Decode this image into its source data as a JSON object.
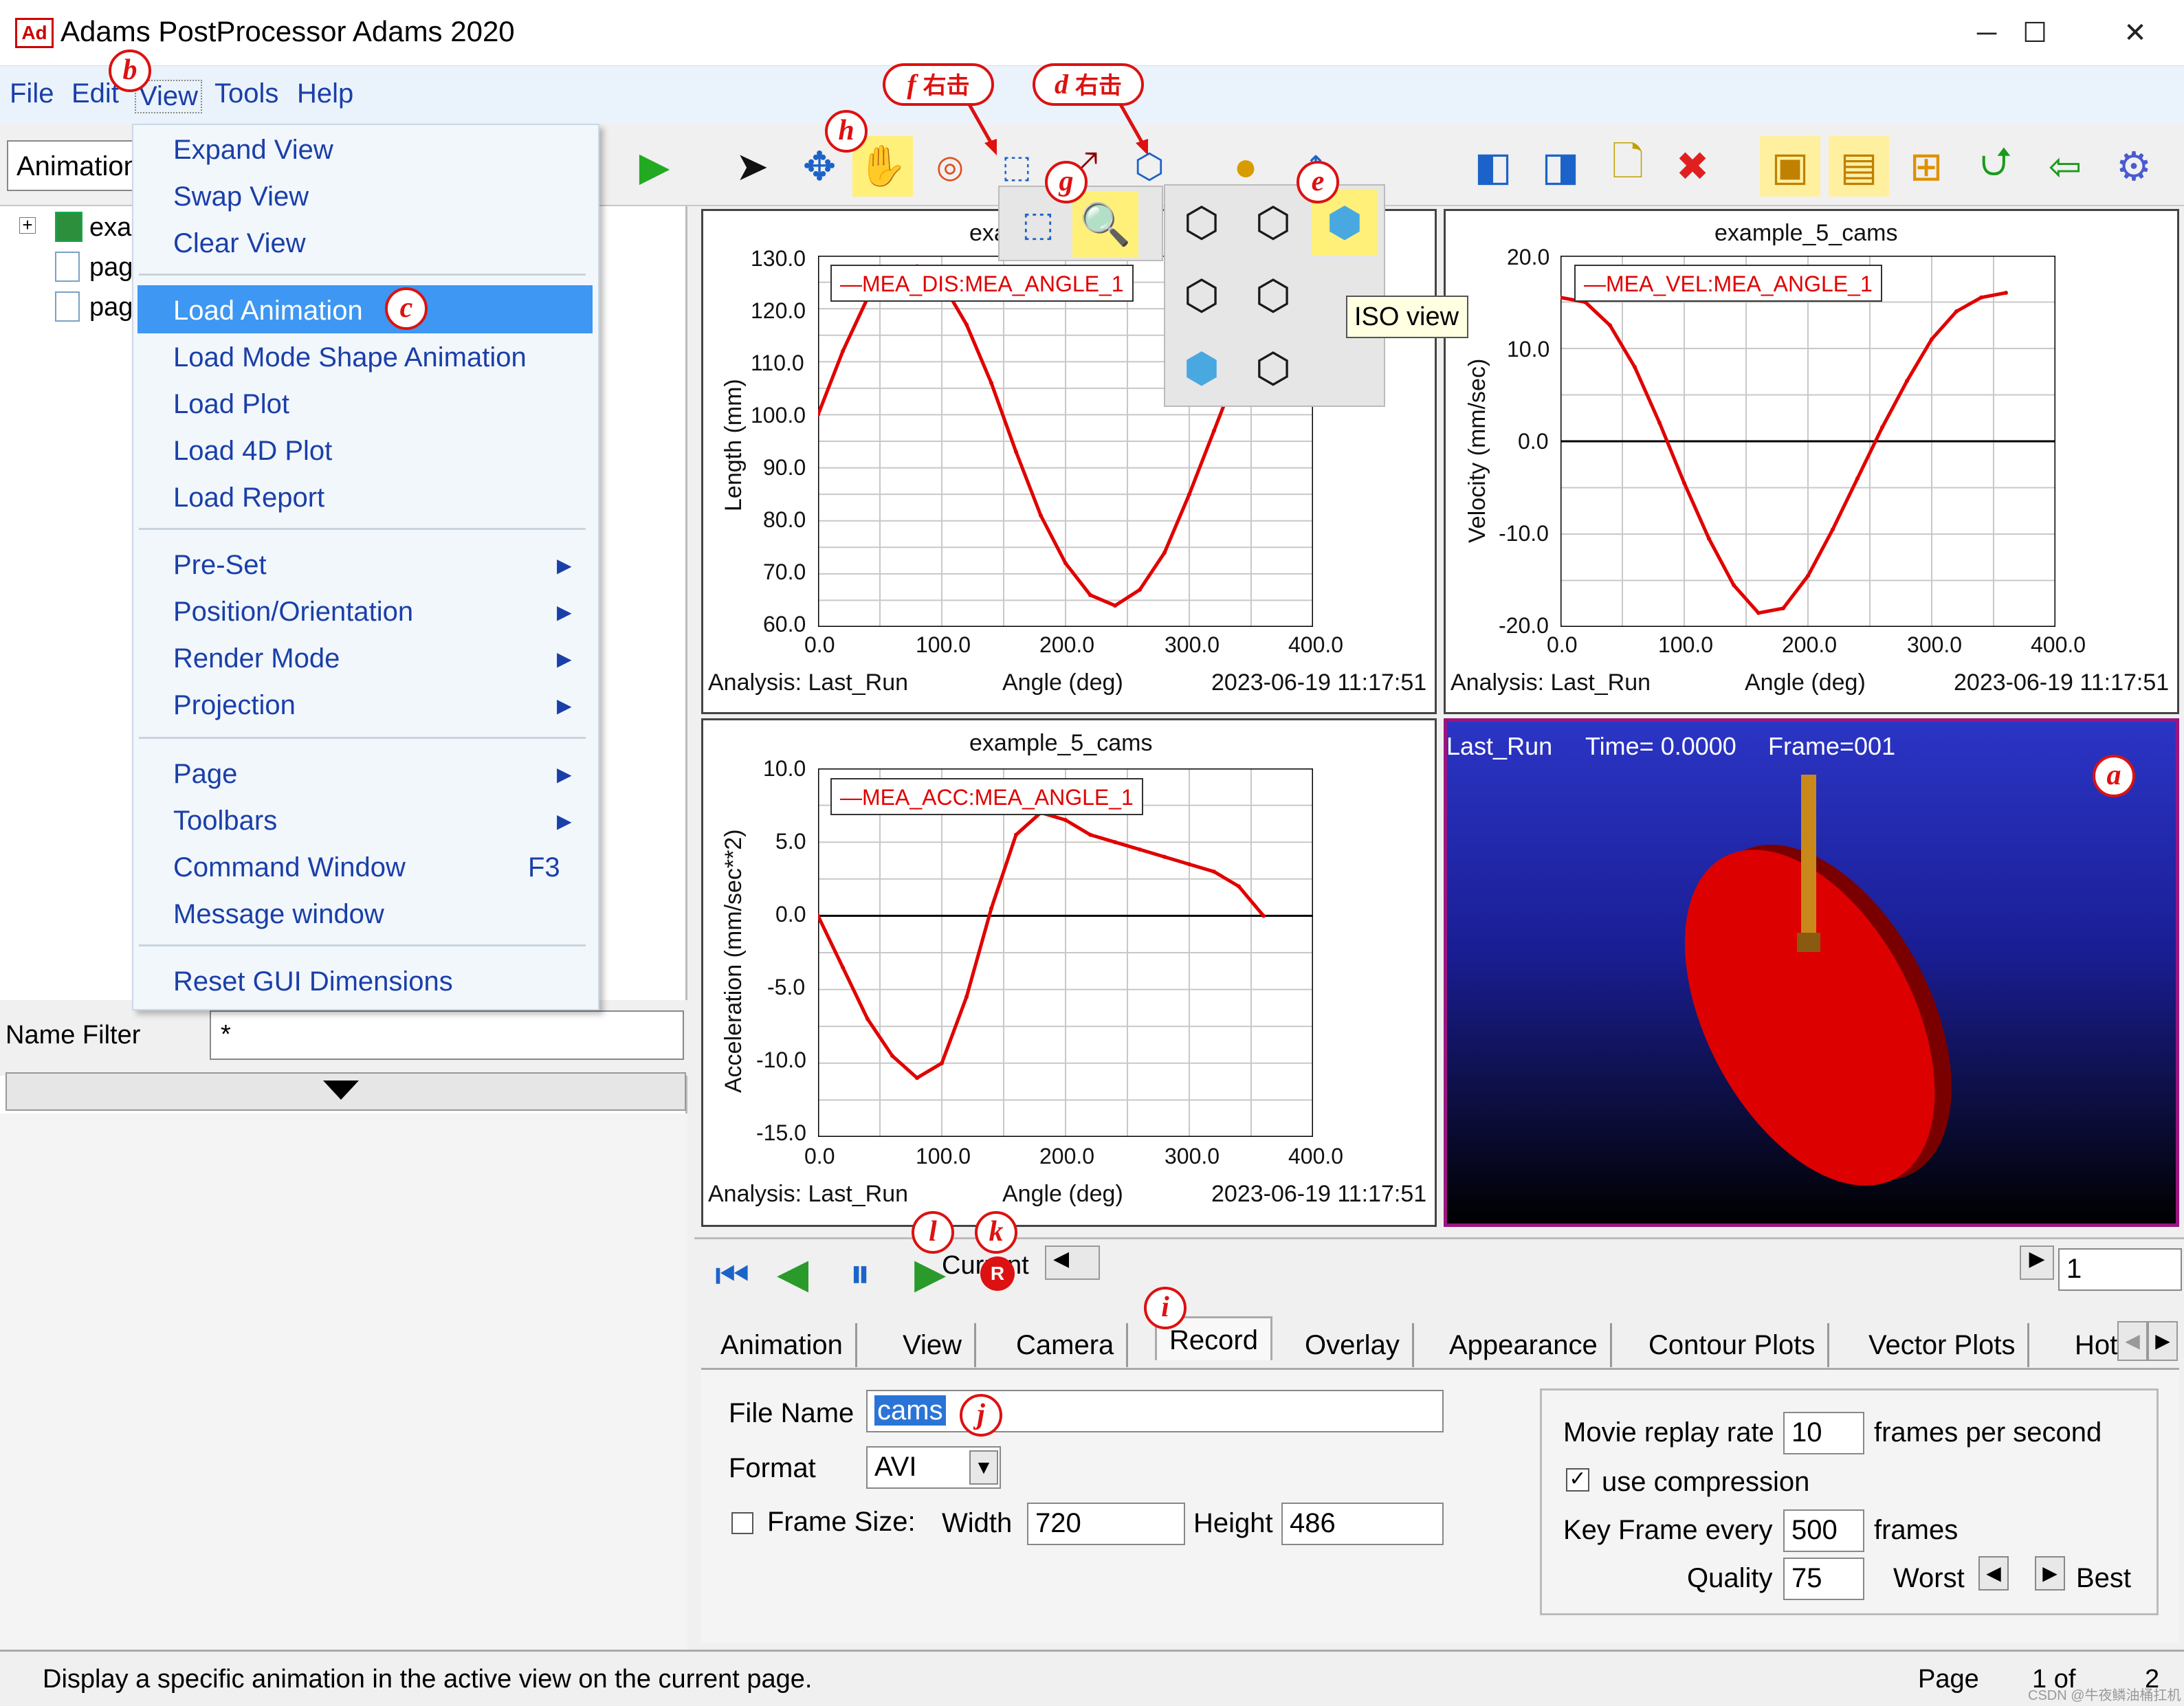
{
  "window": {
    "title": "Adams PostProcessor Adams 2020",
    "logo": "Ad",
    "minimize": "─",
    "maximize": "☐",
    "close": "✕"
  },
  "menubar": {
    "items": [
      "File",
      "Edit",
      "View",
      "Tools",
      "Help"
    ]
  },
  "toolbar": {
    "mode_value": "Animation"
  },
  "tree": {
    "items": [
      "exa",
      "pag",
      "pag"
    ]
  },
  "name_filter": {
    "label": "Name Filter",
    "value": "*"
  },
  "view_menu": {
    "items": [
      {
        "label": "Expand View"
      },
      {
        "label": "Swap View"
      },
      {
        "label": "Clear View"
      },
      {
        "label": "Load Animation"
      },
      {
        "label": "Load Mode Shape Animation"
      },
      {
        "label": "Load Plot"
      },
      {
        "label": "Load 4D Plot"
      },
      {
        "label": "Load Report"
      },
      {
        "label": "Pre-Set"
      },
      {
        "label": "Position/Orientation"
      },
      {
        "label": "Render Mode"
      },
      {
        "label": "Projection"
      },
      {
        "label": "Page"
      },
      {
        "label": "Toolbars"
      },
      {
        "label": "Command Window",
        "shortcut": "F3"
      },
      {
        "label": "Message window"
      },
      {
        "label": "Reset GUI Dimensions"
      }
    ]
  },
  "tooltip": "ISO view",
  "callouts": {
    "a": "a",
    "b": "b",
    "c": "c",
    "d": "d",
    "e": "e",
    "f": "f",
    "g": "g",
    "h": "h",
    "i": "i",
    "j": "j",
    "k": "k",
    "l": "l",
    "right_click": "右击"
  },
  "plots": [
    {
      "title": "example_5_cams",
      "legend": "MEA_DIS:MEA_ANGLE_1",
      "ylabel": "Length (mm)",
      "xlabel": "Angle (deg)",
      "analysis": "Analysis:  Last_Run",
      "timestamp": "2023-06-19 11:17:51",
      "yticks": [
        "130.0",
        "120.0",
        "110.0",
        "100.0",
        "90.0",
        "80.0",
        "70.0",
        "60.0"
      ],
      "xticks": [
        "0.0",
        "100.0",
        "200.0",
        "300.0",
        "400.0"
      ]
    },
    {
      "title": "example_5_cams",
      "legend": "MEA_VEL:MEA_ANGLE_1",
      "ylabel": "Velocity (mm/sec)",
      "xlabel": "Angle (deg)",
      "analysis": "Analysis:  Last_Run",
      "timestamp": "2023-06-19 11:17:51",
      "yticks": [
        "20.0",
        "10.0",
        "0.0",
        "-10.0",
        "-20.0"
      ],
      "xticks": [
        "0.0",
        "100.0",
        "200.0",
        "300.0",
        "400.0"
      ]
    },
    {
      "title": "example_5_cams",
      "legend": "MEA_ACC:MEA_ANGLE_1",
      "ylabel": "Acceleration (mm/sec**2)",
      "xlabel": "Angle (deg)",
      "analysis": "Analysis:  Last_Run",
      "timestamp": "2023-06-19 11:17:51",
      "yticks": [
        "10.0",
        "5.0",
        "0.0",
        "-5.0",
        "-10.0",
        "-15.0"
      ],
      "xticks": [
        "0.0",
        "100.0",
        "200.0",
        "300.0",
        "400.0"
      ]
    }
  ],
  "chart_data": [
    {
      "type": "line",
      "title": "example_5_cams",
      "xlabel": "Angle (deg)",
      "ylabel": "Length (mm)",
      "xlim": [
        0,
        400
      ],
      "ylim": [
        60,
        130
      ],
      "series": [
        {
          "name": "MEA_DIS:MEA_ANGLE_1",
          "x": [
            0,
            20,
            40,
            60,
            80,
            100,
            120,
            140,
            160,
            180,
            200,
            220,
            240,
            260,
            280,
            300,
            320,
            340,
            360
          ],
          "y": [
            100,
            112,
            122,
            127,
            128,
            125,
            117,
            106,
            93,
            81,
            72,
            66,
            64,
            67,
            74,
            85,
            97,
            109,
            118
          ]
        }
      ]
    },
    {
      "type": "line",
      "title": "example_5_cams",
      "xlabel": "Angle (deg)",
      "ylabel": "Velocity (mm/sec)",
      "xlim": [
        0,
        400
      ],
      "ylim": [
        -20,
        20
      ],
      "series": [
        {
          "name": "MEA_VEL:MEA_ANGLE_1",
          "x": [
            0,
            20,
            40,
            60,
            80,
            100,
            120,
            140,
            160,
            180,
            200,
            220,
            240,
            260,
            280,
            300,
            320,
            340,
            360
          ],
          "y": [
            15.5,
            15,
            12.5,
            8,
            2,
            -4.5,
            -10.5,
            -15.5,
            -18.5,
            -18,
            -14.5,
            -9.5,
            -4,
            1.5,
            6.5,
            11,
            14,
            15.5,
            16
          ]
        }
      ]
    },
    {
      "type": "line",
      "title": "example_5_cams",
      "xlabel": "Angle (deg)",
      "ylabel": "Acceleration (mm/sec**2)",
      "xlim": [
        0,
        400
      ],
      "ylim": [
        -15,
        10
      ],
      "series": [
        {
          "name": "MEA_ACC:MEA_ANGLE_1",
          "x": [
            0,
            20,
            40,
            60,
            80,
            100,
            120,
            140,
            160,
            180,
            200,
            220,
            240,
            260,
            280,
            300,
            320,
            340,
            360
          ],
          "y": [
            0,
            -3.5,
            -7,
            -9.5,
            -11,
            -10,
            -5.5,
            0.5,
            5.5,
            7,
            6.5,
            5.5,
            5,
            4.5,
            4,
            3.5,
            3,
            2,
            0
          ]
        }
      ]
    }
  ],
  "animation": {
    "run": "Last_Run",
    "time": "Time=  0.0000",
    "frame": "Frame=001",
    "pin_color": "#c8891a",
    "disc_color": "#dd0000"
  },
  "playback": {
    "current_label": "Current",
    "frame_value": "1",
    "record_badge": "R"
  },
  "tabs": [
    "Animation",
    "View",
    "Camera",
    "Record",
    "Overlay",
    "Appearance",
    "Contour Plots",
    "Vector Plots",
    "Hot"
  ],
  "record": {
    "file_name_label": "File Name",
    "file_name_value": "cams",
    "format_label": "Format",
    "format_value": "AVI",
    "frame_size_label": "Frame Size:",
    "frame_size_checked": false,
    "width_label": "Width",
    "width_value": "720",
    "height_label": "Height",
    "height_value": "486",
    "replay_label": "Movie replay rate",
    "replay_value": "10",
    "replay_unit": "frames per second",
    "compression_label": "use compression",
    "compression_checked": true,
    "keyframe_label": "Key Frame every",
    "keyframe_value": "500",
    "keyframe_unit": "frames",
    "quality_label": "Quality",
    "quality_value": "75",
    "worst_label": "Worst",
    "best_label": "Best"
  },
  "status": {
    "message": "Display a specific animation in the active view on the current page.",
    "page_label": "Page",
    "page_value": "1 of",
    "page_total": "2"
  },
  "watermark": "CSDN @牛夜鳞油桶扛机"
}
